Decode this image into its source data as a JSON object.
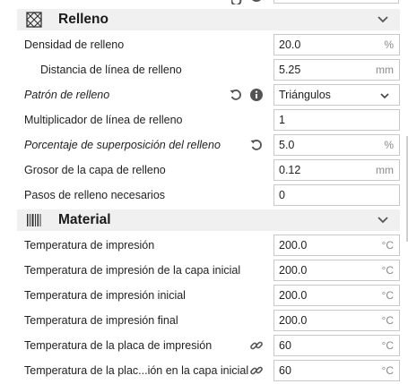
{
  "sections": {
    "infill": {
      "title": "Relleno",
      "icon": "infill-icon"
    },
    "material": {
      "title": "Material",
      "icon": "material-icon"
    }
  },
  "infill_rows": [
    {
      "label": "Densidad de relleno",
      "value": "20.0",
      "unit": "%"
    },
    {
      "label": "Distancia de línea de relleno",
      "value": "5.25",
      "unit": "mm"
    },
    {
      "label": "Patrón de relleno",
      "value": "Triángulos",
      "unit": ""
    },
    {
      "label": "Multiplicador de línea de relleno",
      "value": "1",
      "unit": ""
    },
    {
      "label": "Porcentaje de superposición del relleno",
      "value": "5.0",
      "unit": "%"
    },
    {
      "label": "Grosor de la capa de relleno",
      "value": "0.12",
      "unit": "mm"
    },
    {
      "label": "Pasos de relleno necesarios",
      "value": "0",
      "unit": ""
    }
  ],
  "material_rows": [
    {
      "label": "Temperatura de impresión",
      "value": "200.0",
      "unit": "°C"
    },
    {
      "label": "Temperatura de impresión de la capa inicial",
      "value": "200.0",
      "unit": "°C"
    },
    {
      "label": "Temperatura de impresión inicial",
      "value": "200.0",
      "unit": "°C"
    },
    {
      "label": "Temperatura de impresión final",
      "value": "200.0",
      "unit": "°C"
    },
    {
      "label": "Temperatura de la placa de impresión",
      "value": "60",
      "unit": "°C"
    },
    {
      "label": "Temperatura de la plac...ión en la capa inicial",
      "value": "60",
      "unit": "°C"
    }
  ],
  "colors": {
    "section_bg": "#f0f0f0",
    "field_border": "#c9c9c9",
    "unit": "#8a8a8a",
    "icon": "#555555"
  }
}
